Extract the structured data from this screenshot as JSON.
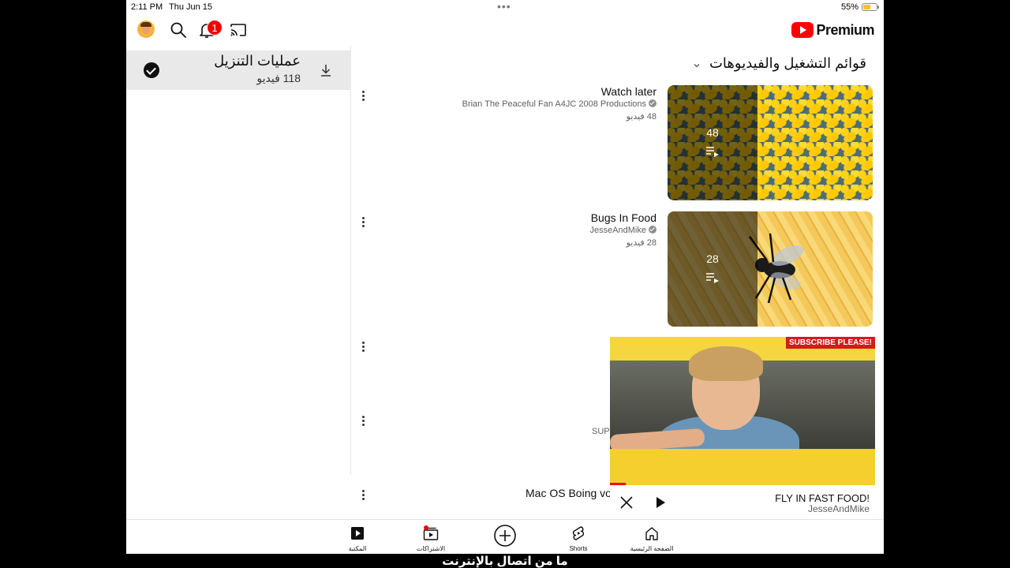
{
  "status_bar": {
    "time": "2:11 PM",
    "date": "Thu Jun 15",
    "battery_percent": "55%",
    "battery_level": 0.55
  },
  "header": {
    "brand": "Premium",
    "notification_count": "1",
    "icons": [
      "avatar",
      "search-icon",
      "bell-icon",
      "cast-icon",
      "youtube-logo"
    ]
  },
  "downloads": {
    "title": "عمليات التنزيل",
    "count": "118 فيديو",
    "icons": [
      "check-circle-icon",
      "download-icon"
    ]
  },
  "section": {
    "title": "قوائم التشغيل والفيديوهات"
  },
  "playlists": [
    {
      "title": "Watch later",
      "channel": "Brian The Peaceful Fan A4JC 2008 Productions",
      "count_label": "48 فيديو",
      "thumb_count": "48"
    },
    {
      "title": "Bugs In Food",
      "channel": "JesseAndMike",
      "count_label": "28 فيديو",
      "thumb_count": "28"
    }
  ],
  "partial_rows": {
    "row4_text": "SUP",
    "row5_title": "Mac OS Boing vo"
  },
  "mini_player": {
    "overlay_tag": "SUBSCRIBE PLEASE!",
    "title": "FLY IN FAST FOOD!",
    "channel": "JesseAndMike",
    "progress": 0.06
  },
  "bottom_nav": {
    "library": "المكتبة",
    "subscriptions": "الاشتراكات",
    "shorts": "Shorts",
    "home": "الصفحة الرئيسية"
  },
  "offline_caption": "ما من اتصال بالإنترنت"
}
